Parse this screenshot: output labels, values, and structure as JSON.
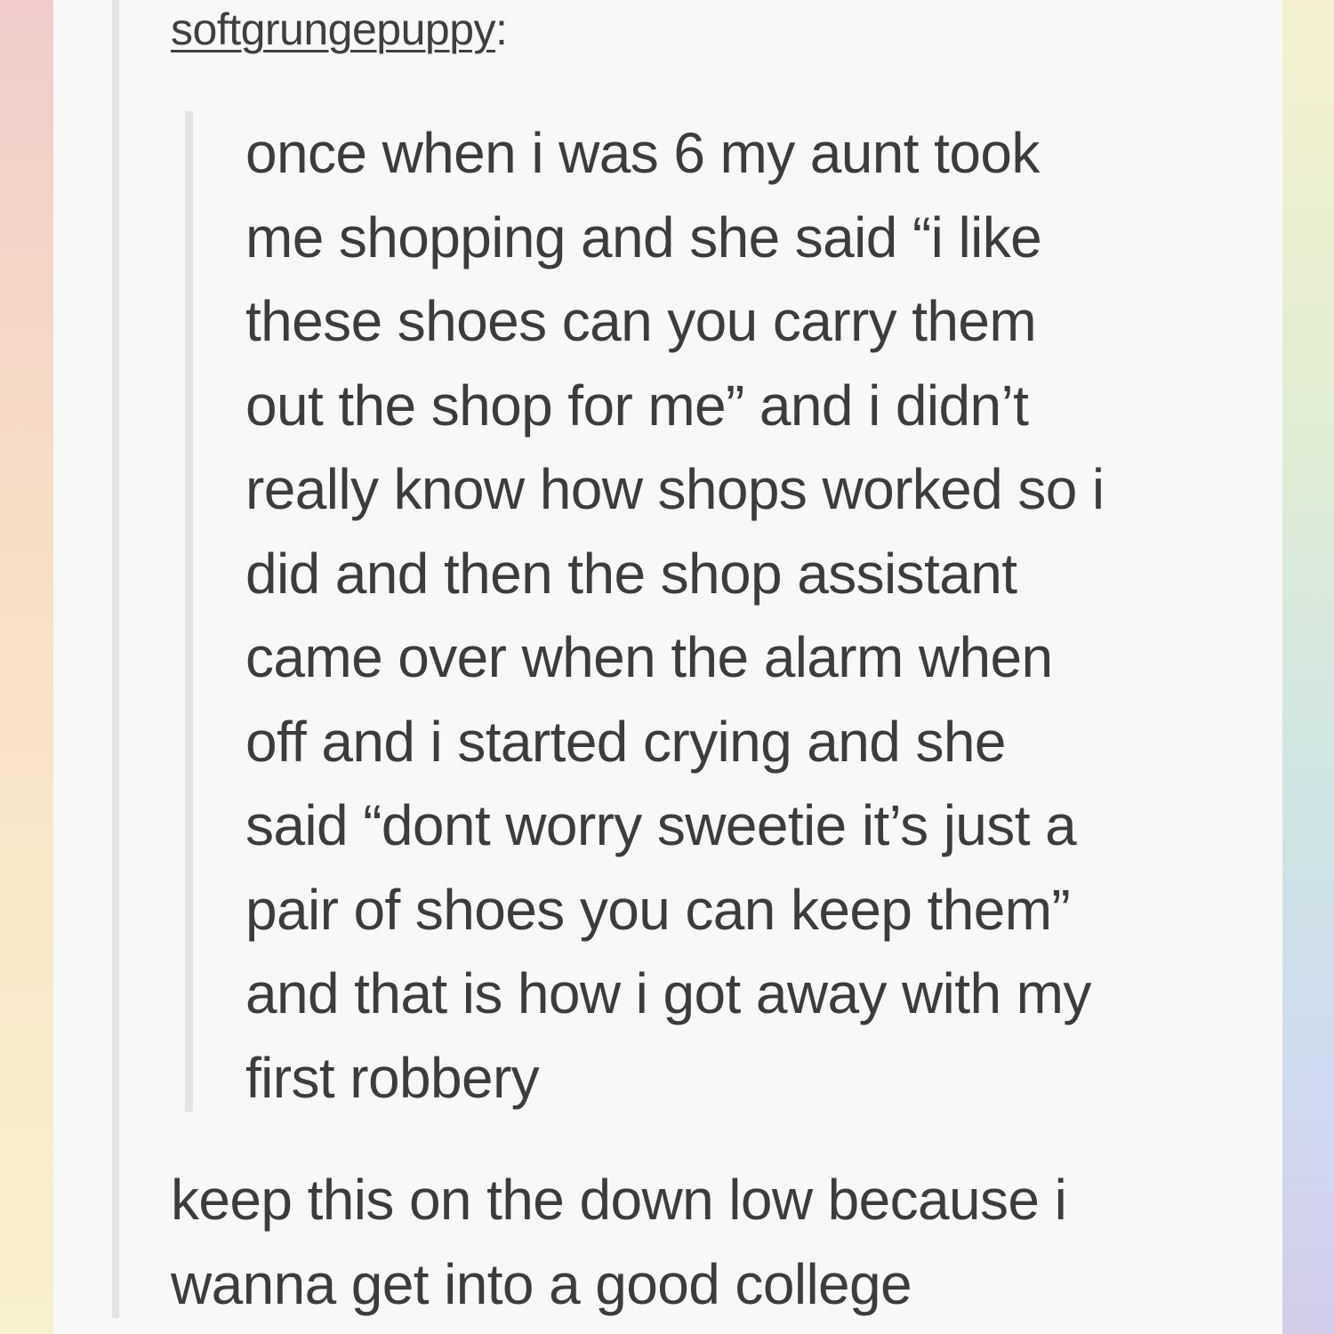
{
  "post": {
    "username": "softgrungepuppy",
    "username_suffix": ":",
    "quote_lines": [
      "once when i was 6 my aunt took",
      "me shopping and she said “i like",
      "these shoes can you carry them",
      "out the shop for me” and i didn’t",
      "really know how shops worked so i",
      "did and then the shop assistant",
      "came over when the alarm when",
      "off and i started crying and she",
      "said “dont worry sweetie it’s just a",
      "pair of shoes you can keep them”",
      "and that is how i got away with my",
      "first robbery"
    ],
    "reply_lines": [
      "keep this on the down low because i",
      "wanna get into a good college"
    ]
  },
  "colors": {
    "post_background": "#f8f8f7",
    "text": "#3c3c3c",
    "quote_bar": "#e3e3e1",
    "frame_left_gradient": [
      "#f1cccb",
      "#f6dcc6",
      "#f8e8c8",
      "#f9f0cd"
    ],
    "frame_right_gradient": [
      "#f6f0cf",
      "#e2eed3",
      "#cfe4e4",
      "#cfdaf0",
      "#d3cde8"
    ]
  }
}
